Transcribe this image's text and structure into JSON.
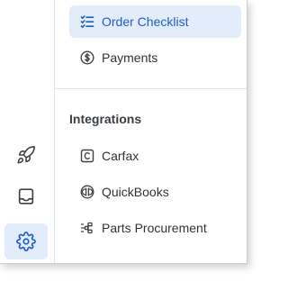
{
  "rail": {
    "items": [
      {
        "icon": "rocket-icon",
        "active": false
      },
      {
        "icon": "inbox-icon",
        "active": false
      },
      {
        "icon": "gear-icon",
        "active": true
      }
    ]
  },
  "menu": {
    "top_items": [
      {
        "label": "Order Checklist",
        "icon": "checklist-icon",
        "active": true
      },
      {
        "label": "Payments",
        "icon": "dollar-circle-icon",
        "active": false
      }
    ],
    "integrations": {
      "title": "Integrations",
      "items": [
        {
          "label": "Carfax",
          "icon": "carfax-icon"
        },
        {
          "label": "QuickBooks",
          "icon": "quickbooks-icon"
        },
        {
          "label": "Parts Procurement",
          "icon": "parts-procurement-icon"
        }
      ]
    }
  },
  "colors": {
    "accent": "#1f5fc4",
    "active_bg": "#e3ecfb",
    "text": "#2f3337",
    "icon": "#3d4247"
  }
}
